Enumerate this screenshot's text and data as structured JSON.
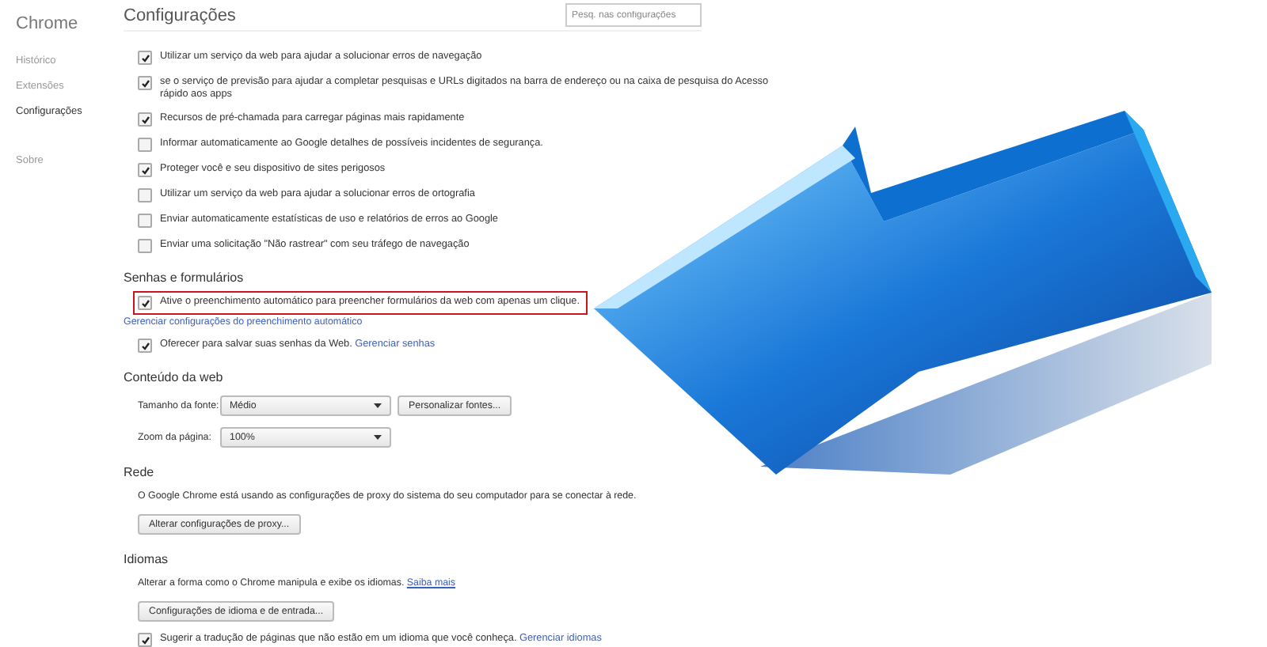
{
  "sidebar": {
    "title": "Chrome",
    "items": [
      {
        "label": "Histórico",
        "selected": false
      },
      {
        "label": "Extensões",
        "selected": false
      },
      {
        "label": "Configurações",
        "selected": true
      },
      {
        "label": "Sobre",
        "selected": false
      }
    ]
  },
  "header": {
    "title": "Configurações",
    "search": {
      "placeholder": "Pesq. nas configurações"
    }
  },
  "sections": [
    {
      "items": [
        {
          "kind": "checkbox",
          "label": "Utilizar um serviço da web para ajudar a solucionar erros de navegação",
          "checked": true
        },
        {
          "kind": "checkbox",
          "label": "se o serviço de previsão para ajudar a completar pesquisas e URLs digitados na barra de endereço ou na caixa de pesquisa do Acesso rápido aos apps",
          "checked": true
        },
        {
          "kind": "checkbox",
          "label": "Recursos de pré-chamada para carregar páginas mais rapidamente",
          "checked": true
        },
        {
          "kind": "checkbox",
          "label": "Informar automaticamente ao Google detalhes de possíveis incidentes de segurança.",
          "checked": false
        },
        {
          "kind": "checkbox",
          "label": "Proteger você e seu dispositivo de sites perigosos",
          "checked": true
        },
        {
          "kind": "checkbox",
          "label": "Utilizar um serviço da web para ajudar a solucionar erros de ortografia",
          "checked": false
        },
        {
          "kind": "checkbox",
          "label": "Enviar automaticamente estatísticas de uso e relatórios de erros ao Google",
          "checked": false
        },
        {
          "kind": "checkbox",
          "label": "Enviar uma solicitação \"Não rastrear\" com seu tráfego de navegação",
          "checked": false
        }
      ]
    },
    {
      "heading": "Senhas e formulários",
      "items": [
        {
          "kind": "checkbox",
          "label": "Ative o preenchimento automático para preencher formulários da web com apenas um clique.",
          "checked": true,
          "highlighted": true
        },
        {
          "kind": "link",
          "label": "Gerenciar configurações do preenchimento automático"
        },
        {
          "kind": "checkbox",
          "label": "Oferecer para salvar suas senhas da Web.",
          "link": "Gerenciar senhas",
          "checked": true
        }
      ]
    },
    {
      "heading": "Conteúdo da web",
      "items": [
        {
          "kind": "select",
          "label": "Tamanho da fonte:",
          "value": "Médio",
          "button": "Personalizar fontes..."
        },
        {
          "kind": "select",
          "label": "Zoom da página:",
          "value": "100%"
        }
      ]
    },
    {
      "heading": "Rede",
      "items": [
        {
          "kind": "text",
          "text": "O Google Chrome está usando as configurações de proxy do sistema do seu computador para se conectar à rede."
        },
        {
          "kind": "button",
          "label": "Alterar configurações de proxy..."
        }
      ]
    },
    {
      "heading": "Idiomas",
      "items": [
        {
          "kind": "text",
          "text": "Alterar a forma como o Chrome manipula e exibe os idiomas.",
          "link": "Saiba mais"
        },
        {
          "kind": "button",
          "label": "Configurações de idioma e de entrada..."
        },
        {
          "kind": "checkbox",
          "label": "Sugerir a tradução de páginas que não estão em um idioma que você conheça.",
          "link": "Gerenciar idiomas",
          "checked": true
        }
      ]
    }
  ]
}
